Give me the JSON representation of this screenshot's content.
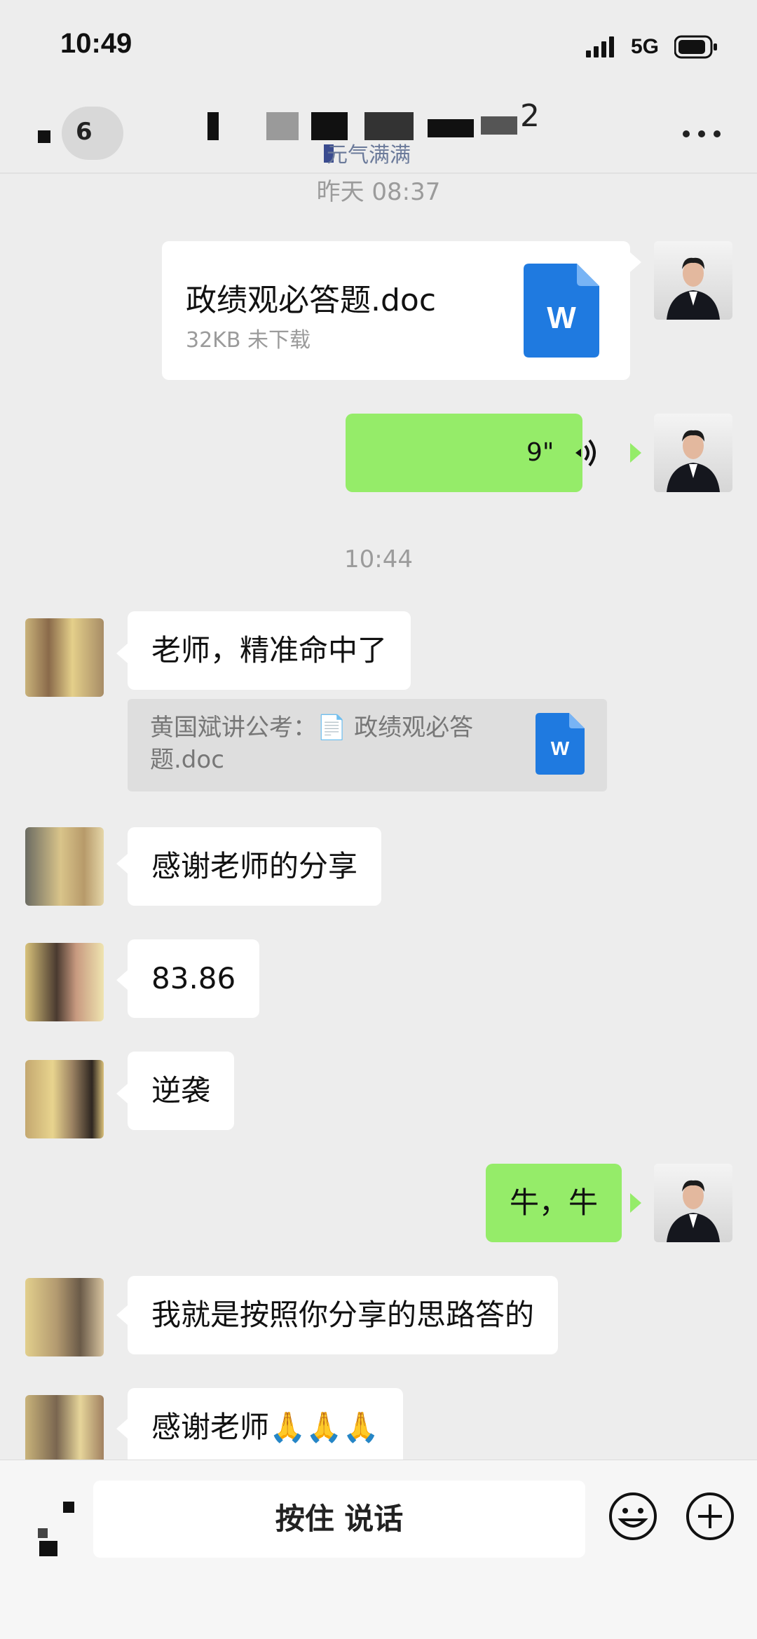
{
  "status_bar": {
    "time": "10:49",
    "network": "5G"
  },
  "header": {
    "badge": "6",
    "title_visible_end": "2",
    "subtitle": "元气满满",
    "more_icon": "more-dots-icon"
  },
  "messages": {
    "ts_yesterday": "昨天 08:37",
    "file_name": "政绩观必答题.doc",
    "file_meta": "32KB  未下载",
    "file_icon_letter": "W",
    "voice_duration": "9\"",
    "ts_today": "10:44",
    "m1": "老师，精准命中了",
    "quote_text": "黄国斌讲公考：📄 政绩观必答题.doc",
    "quote_icon_letter": "W",
    "m2": "感谢老师的分享",
    "m3": "83.86",
    "m4": "逆袭",
    "m5": "牛，牛",
    "m6": "我就是按照你分享的思路答的",
    "m7": "感谢老师🙏🙏🙏"
  },
  "input_bar": {
    "talk_label": "按住 说话",
    "emoji_icon": "emoji-icon",
    "plus_icon": "plus-icon"
  },
  "colors": {
    "self_bubble": "#95ec69",
    "other_bubble": "#ffffff",
    "background": "#ededed",
    "doc_blue": "#1f7ae0"
  }
}
